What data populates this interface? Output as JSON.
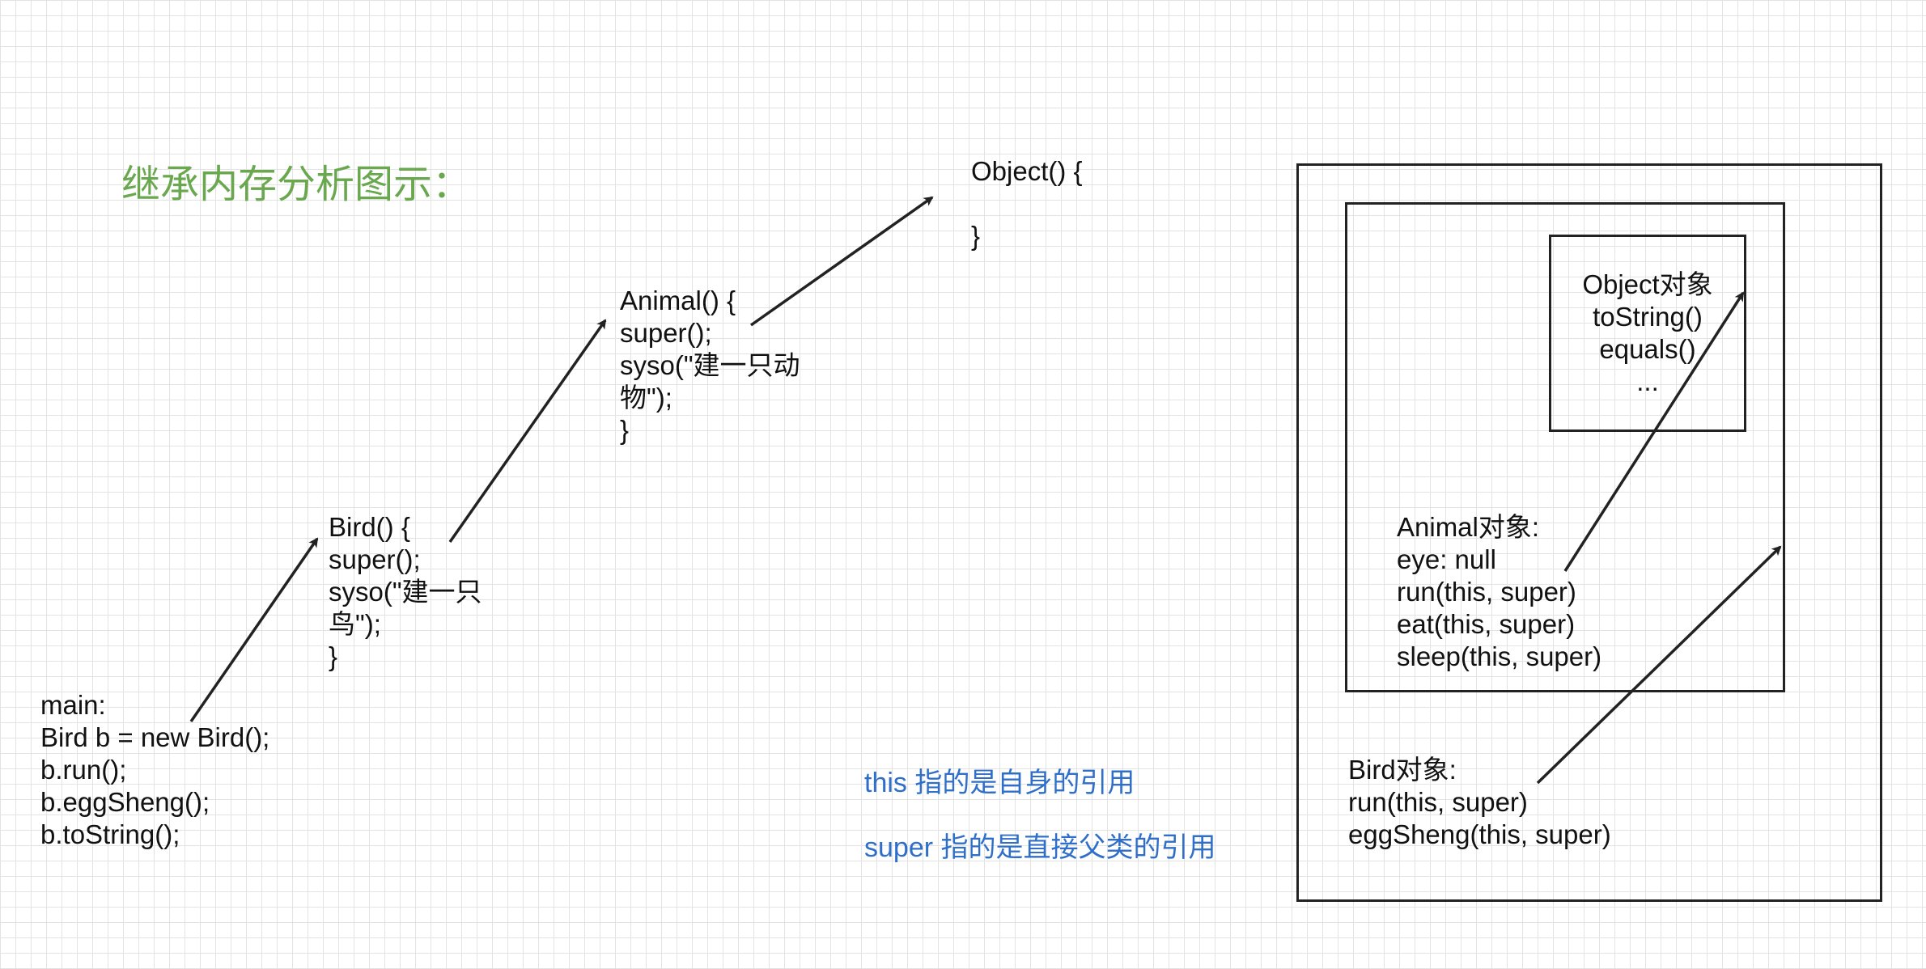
{
  "title": "继承内存分析图示：",
  "code_blocks": {
    "main": "main:\n  Bird b = new Bird();\n  b.run();\n  b.eggSheng();\n  b.toString();",
    "bird_ctor": "Bird() {\n  super();\n  syso(\"建一只\n鸟\");\n}",
    "animal_ctor": "Animal() {\n  super();\n  syso(\"建一只动\n物\");\n}",
    "object_ctor": "Object() {\n\n}"
  },
  "note": {
    "line1": "this 指的是自身的引用",
    "line2": "super 指的是直接父类的引用"
  },
  "memory": {
    "object_box": "Object对象\ntoString()\nequals()\n...",
    "animal_box": "Animal对象:\neye: null\nrun(this, super)\neat(this, super)\nsleep(this, super)",
    "bird_box": "Bird对象:\nrun(this, super)\neggSheng(this, super)"
  },
  "colors": {
    "title": "#6aa84f",
    "note": "#2f6fc9",
    "stroke": "#222222"
  }
}
